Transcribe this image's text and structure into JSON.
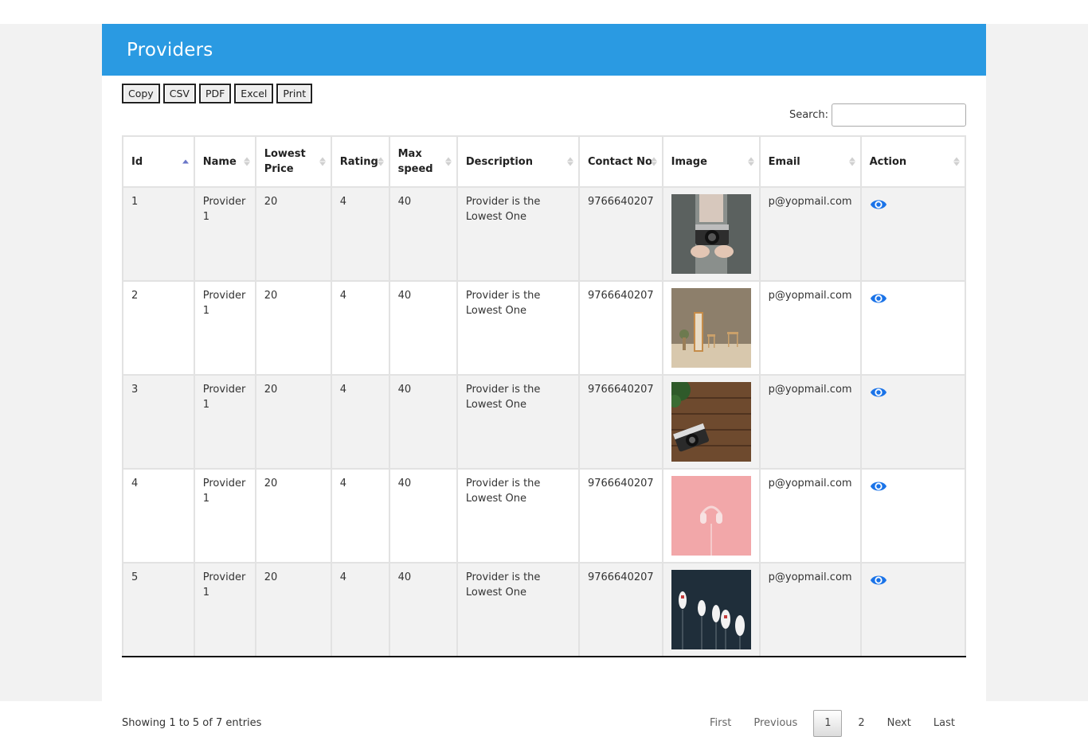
{
  "page": {
    "title": "Providers"
  },
  "toolbar": {
    "buttons": [
      "Copy",
      "CSV",
      "PDF",
      "Excel",
      "Print"
    ]
  },
  "search": {
    "label": "Search:",
    "value": ""
  },
  "table": {
    "columns": [
      "Id",
      "Name",
      "Lowest Price",
      "Rating",
      "Max speed",
      "Description",
      "Contact No",
      "Image",
      "Email",
      "Action"
    ],
    "sorted_column": "Id",
    "rows": [
      {
        "id": "1",
        "name": "Provider 1",
        "lowest_price": "20",
        "rating": "4",
        "max_speed": "40",
        "description": "Provider is the Lowest One",
        "contact": "9766640207",
        "image": "camera-held-in-hands",
        "email": "p@yopmail.com",
        "action_icon": "eye-icon"
      },
      {
        "id": "2",
        "name": "Provider 1",
        "lowest_price": "20",
        "rating": "4",
        "max_speed": "40",
        "description": "Provider is the Lowest One",
        "contact": "9766640207",
        "image": "room-with-mirror-and-stools",
        "email": "p@yopmail.com",
        "action_icon": "eye-icon"
      },
      {
        "id": "3",
        "name": "Provider 1",
        "lowest_price": "20",
        "rating": "4",
        "max_speed": "40",
        "description": "Provider is the Lowest One",
        "contact": "9766640207",
        "image": "camera-on-wooden-table",
        "email": "p@yopmail.com",
        "action_icon": "eye-icon"
      },
      {
        "id": "4",
        "name": "Provider 1",
        "lowest_price": "20",
        "rating": "4",
        "max_speed": "40",
        "description": "Provider is the Lowest One",
        "contact": "9766640207",
        "image": "headphones-on-pink",
        "email": "p@yopmail.com",
        "action_icon": "eye-icon"
      },
      {
        "id": "5",
        "name": "Provider 1",
        "lowest_price": "20",
        "rating": "4",
        "max_speed": "40",
        "description": "Provider is the Lowest One",
        "contact": "9766640207",
        "image": "boats-aerial-view",
        "email": "p@yopmail.com",
        "action_icon": "eye-icon"
      }
    ]
  },
  "footer": {
    "info": "Showing 1 to 5 of 7 entries",
    "pagination": {
      "first": "First",
      "previous": "Previous",
      "pages": [
        "1",
        "2"
      ],
      "current": "1",
      "next": "Next",
      "last": "Last"
    }
  },
  "colors": {
    "header": "#2a9ae2",
    "eye_icon": "#1a73e8",
    "sort_active": "#6a76c8"
  }
}
